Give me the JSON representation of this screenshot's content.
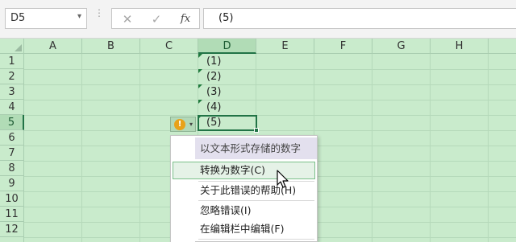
{
  "formula_bar": {
    "name_box": "D5",
    "name_box_arrow": "▾",
    "dots": "⋮",
    "cancel_icon": "✕",
    "enter_icon": "✓",
    "fx_label": "fx",
    "formula": "(5)"
  },
  "columns": [
    "A",
    "B",
    "C",
    "D",
    "E",
    "F",
    "G",
    "H"
  ],
  "rows": [
    "1",
    "2",
    "3",
    "4",
    "5",
    "6",
    "7",
    "8",
    "9",
    "10",
    "11",
    "12"
  ],
  "active_cell": {
    "column": "D",
    "row": "5"
  },
  "cells_D": [
    "(1)",
    "(2)",
    "(3)",
    "(4)",
    "(5)"
  ],
  "smart_tag": {
    "icon": "!",
    "arrow": "▾"
  },
  "context_menu": {
    "header": "以文本形式存储的数字",
    "items": [
      {
        "label": "转换为数字(C)",
        "hover": true
      },
      {
        "label": "关于此错误的帮助(H)",
        "hover": false
      },
      {
        "label": "忽略错误(I)",
        "hover": false
      },
      {
        "label": "在编辑栏中编辑(F)",
        "hover": false
      }
    ]
  },
  "colors": {
    "grid_background": "#c9ebcc",
    "selection_border": "#217346",
    "warning_icon": "#e8a21a",
    "menu_header": "#e3e0ee"
  },
  "icons": [
    "chevron-down-icon",
    "close-icon",
    "check-icon",
    "function-icon",
    "warning-icon",
    "pointer-cursor-icon"
  ]
}
